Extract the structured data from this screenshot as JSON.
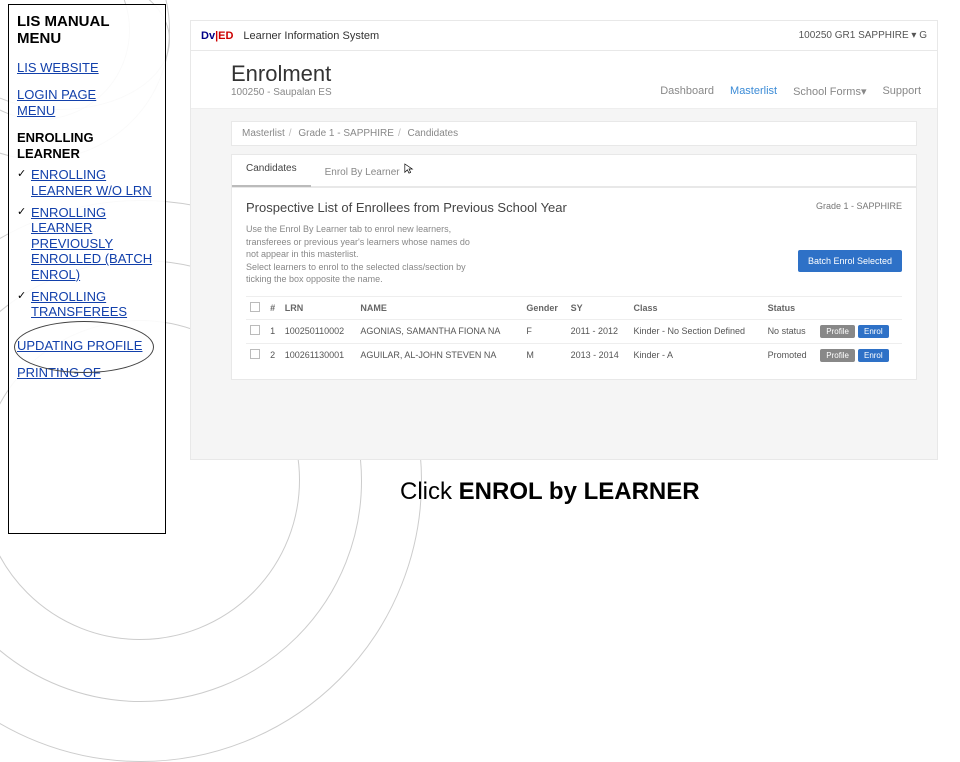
{
  "sidebar": {
    "title": "LIS MANUAL MENU",
    "links": {
      "website": "LIS WEBSITE",
      "login": "LOGIN PAGE",
      "menu": "MENU",
      "enrolling": "ENROLLING LEARNER",
      "updating": "UPDATING PROFILE",
      "printing": "PRINTING OF"
    },
    "items": [
      "ENROLLING LEARNER W/O LRN",
      "ENROLLING LEARNER PREVIOUSLY ENROLLED (BATCH ENROL)",
      "ENROLLING TRANSFEREES"
    ]
  },
  "shot": {
    "brand1": "Dv",
    "brand2": "|ED",
    "app": "Learner Information System",
    "user": "100250 GR1 SAPPHIRE ▾       G",
    "page": "Enrolment",
    "school": "100250 - Saupalan ES",
    "nav": {
      "dashboard": "Dashboard",
      "masterlist": "Masterlist",
      "forms": "School Forms▾",
      "support": "Support"
    },
    "crumbs": {
      "a": "Masterlist",
      "b": "Grade 1 - SAPPHIRE",
      "c": "Candidates"
    },
    "tabs": {
      "candidates": "Candidates",
      "enrol": "Enrol By Learner"
    },
    "panel": {
      "title": "Prospective List of Enrollees from Previous School Year",
      "section": "Grade 1 - SAPPHIRE",
      "hint1": "Use the Enrol By Learner tab to enrol new learners,",
      "hint2": "transferees or previous year's learners whose names do",
      "hint3": "not appear in this masterlist.",
      "hint4": "Select learners to enrol to the selected class/section by",
      "hint5": "ticking the box opposite the name.",
      "batch": "Batch Enrol Selected",
      "cols": {
        "n": "#",
        "lrn": "LRN",
        "name": "NAME",
        "gender": "Gender",
        "sy": "SY",
        "class": "Class",
        "status": "Status"
      },
      "rows": [
        {
          "n": "1",
          "lrn": "100250110002",
          "name": "AGONIAS, SAMANTHA FIONA NA",
          "gender": "F",
          "sy": "2011 - 2012",
          "class": "Kinder - No Section Defined",
          "status": "No status",
          "profile": "Profile",
          "enrol": "Enrol"
        },
        {
          "n": "2",
          "lrn": "100261130001",
          "name": "AGUILAR, AL-JOHN STEVEN NA",
          "gender": "M",
          "sy": "2013 - 2014",
          "class": "Kinder - A",
          "status": "Promoted",
          "profile": "Profile",
          "enrol": "Enrol"
        }
      ]
    }
  },
  "instruction": {
    "pre": "Click ",
    "bold": "ENROL by LEARNER"
  }
}
